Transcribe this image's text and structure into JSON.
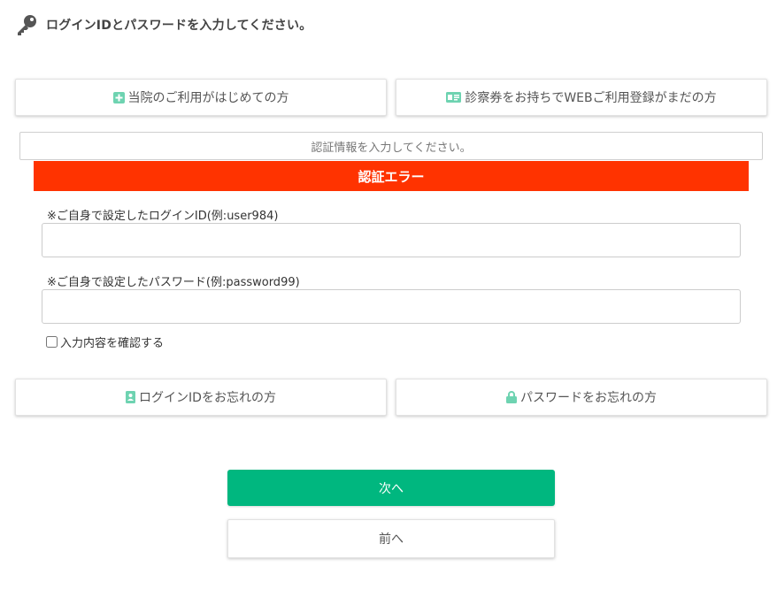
{
  "header": {
    "title": "ログインIDとパスワードを入力してください。",
    "icon": "key-icon"
  },
  "top_buttons": {
    "first_visit_label": "当院のご利用がはじめての方",
    "first_visit_icon": "plus-square-icon",
    "register_label": "診察券をお持ちでWEBご利用登録がまだの方",
    "register_icon": "id-card-icon"
  },
  "auth": {
    "info_text": "認証情報を入力してください。",
    "error_text": "認証エラー"
  },
  "form": {
    "id_label": "※ご自身で設定したログインID(例:user984)",
    "id_value": "",
    "pw_label": "※ご自身で設定したパスワード(例:password99)",
    "pw_value": "",
    "confirm_label": "入力内容を確認する",
    "confirm_checked": false
  },
  "forgot": {
    "id_label": "ログインIDをお忘れの方",
    "id_icon": "contact-card-icon",
    "pw_label": "パスワードをお忘れの方",
    "pw_icon": "lock-icon"
  },
  "nav": {
    "next_label": "次へ",
    "back_label": "前へ"
  },
  "colors": {
    "accent_green": "#00b77f",
    "icon_green": "#6ed3b1",
    "error_red": "#ff3300",
    "key_gray": "#555555"
  }
}
